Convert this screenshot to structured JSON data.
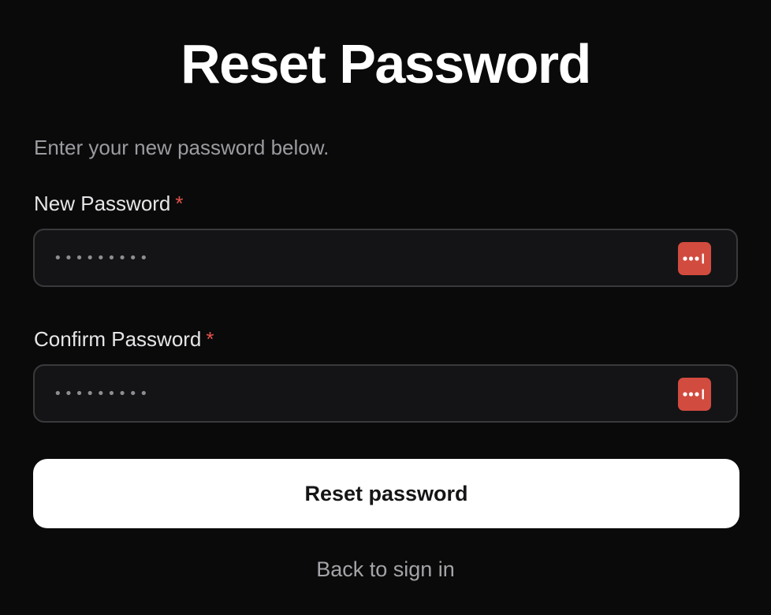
{
  "page": {
    "title": "Reset Password",
    "subtitle": "Enter your new password below."
  },
  "form": {
    "new_password": {
      "label": "New Password",
      "required_mark": "*",
      "value": "•••••••••"
    },
    "confirm_password": {
      "label": "Confirm Password",
      "required_mark": "*",
      "value": "•••••••••"
    },
    "password_manager_icon": "password-manager-icon",
    "submit_label": "Reset password",
    "back_link_label": "Back to sign in"
  },
  "colors": {
    "background": "#0a0a0b",
    "required_asterisk": "#e5534b",
    "password_manager_badge": "#d24b3f",
    "button_bg": "#ffffff",
    "button_text": "#151517",
    "muted_text": "#9b9ba0"
  }
}
